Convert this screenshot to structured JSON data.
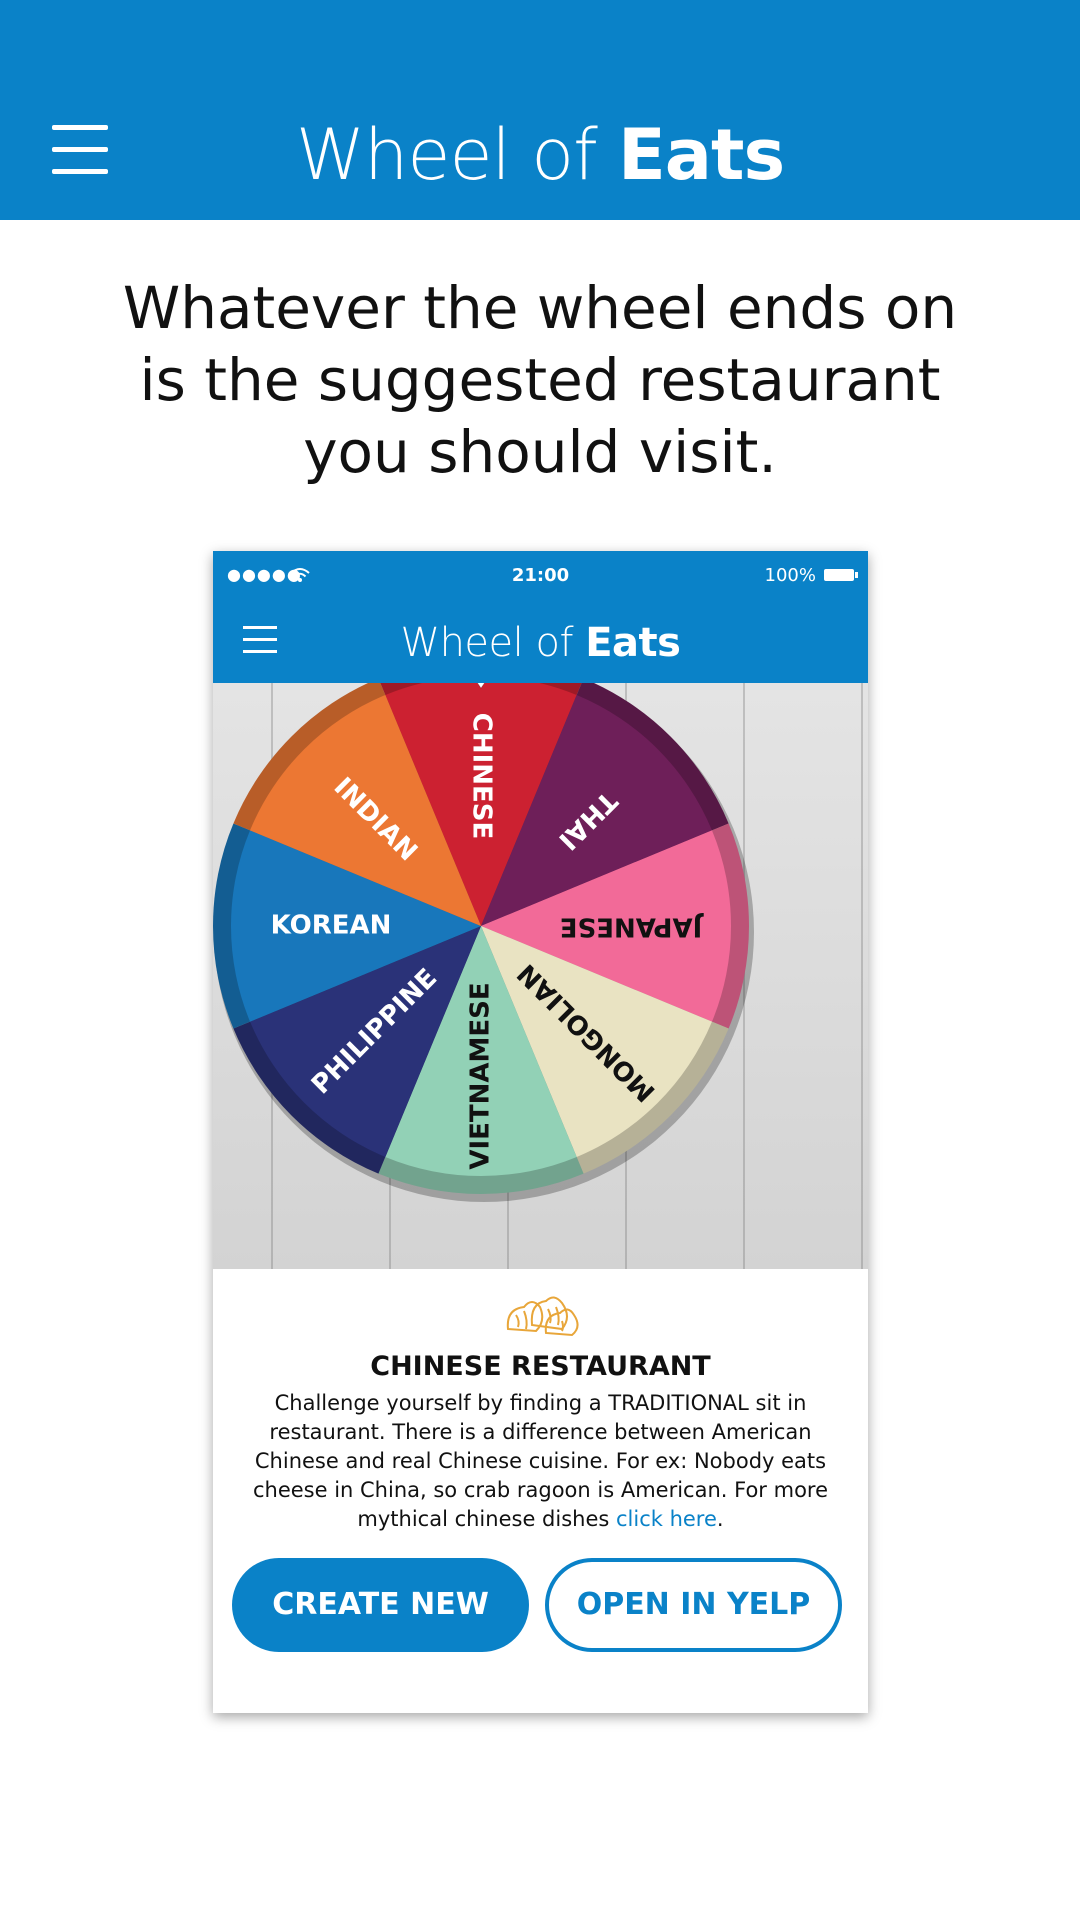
{
  "header": {
    "title_light": "Wheel of ",
    "title_bold": "Eats",
    "menu_icon": "hamburger-menu-icon",
    "background": "#0a82c8"
  },
  "tagline": {
    "line1": "Whatever the wheel ends on",
    "line2": "is the suggested restaurant",
    "line3": "you should visit."
  },
  "phone": {
    "status_bar": {
      "signal": "●●●●●",
      "time": "21:00",
      "battery": "100%"
    },
    "header": {
      "title_light": "Wheel of ",
      "title_bold": "Eats"
    },
    "wheel": {
      "selected": "CHINESE",
      "pointer_icon": "pointer-pin-icon",
      "slices": [
        {
          "label": "CHINESE",
          "color": "#cc2131",
          "text_color": "#ffffff"
        },
        {
          "label": "THAI",
          "color": "#6e1f59",
          "text_color": "#ffffff"
        },
        {
          "label": "JAPANESE",
          "color": "#f26a98",
          "text_color": "#111111"
        },
        {
          "label": "MONGOLIAN",
          "color": "#e9e3c2",
          "text_color": "#111111"
        },
        {
          "label": "VIETNAMESE",
          "color": "#92d1b6",
          "text_color": "#111111"
        },
        {
          "label": "PHILIPPINE",
          "color": "#2a3278",
          "text_color": "#ffffff"
        },
        {
          "label": "KOREAN",
          "color": "#1877bb",
          "text_color": "#ffffff"
        },
        {
          "label": "INDIAN",
          "color": "#ec7733",
          "text_color": "#ffffff"
        }
      ]
    },
    "info": {
      "icon": "dumpling-icon",
      "heading": "CHINESE RESTAURANT",
      "body": "Challenge yourself by finding a TRADITIONAL sit in restaurant. There is a difference between American Chinese and real Chinese cuisine. For ex: Nobody eats cheese in China, so crab ragoon is American. For more mythical chinese dishes ",
      "link": "click here",
      "end": "."
    },
    "buttons": {
      "create_new": "CREATE NEW",
      "open_in_yelp": "OPEN IN YELP"
    }
  }
}
